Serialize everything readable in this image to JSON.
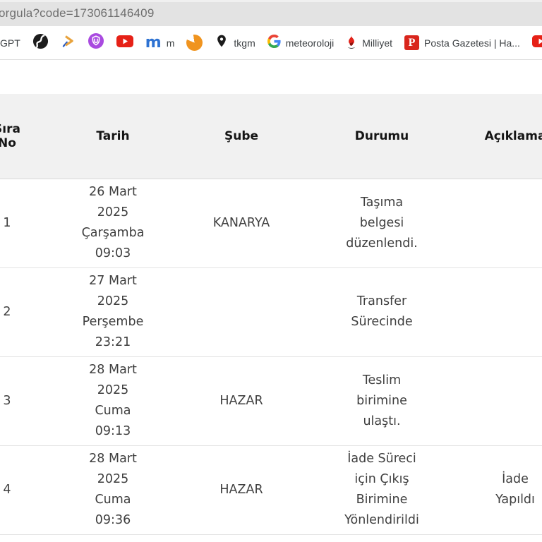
{
  "browser": {
    "address": {
      "url": "orgula?code=173061146409"
    },
    "bookmarks_bar": {
      "items": [
        {
          "label": "GPT",
          "icon": "text-only"
        },
        {
          "label": "",
          "icon": "globe"
        },
        {
          "label": "",
          "icon": "gold-arrow"
        },
        {
          "label": "",
          "icon": "purple-shield"
        },
        {
          "label": "",
          "icon": "youtube"
        },
        {
          "label": "m",
          "icon": "letter-m"
        },
        {
          "label": "",
          "icon": "orange-moon"
        },
        {
          "label": "tkgm",
          "icon": "map-pin"
        },
        {
          "label": "meteoroloji",
          "icon": "google-g"
        },
        {
          "label": "Milliyet",
          "icon": "flame"
        },
        {
          "label": "Posta Gazetesi | Ha...",
          "icon": "letter-p"
        },
        {
          "label": "",
          "icon": "youtube"
        }
      ]
    }
  },
  "table": {
    "headers": [
      "Sıra No",
      "Tarih",
      "Şube",
      "Durumu",
      "Açıklama"
    ],
    "rows": [
      {
        "no": "1",
        "tarih": [
          "26 Mart",
          "2025",
          "Çarşamba",
          "09:03"
        ],
        "sube": "KANARYA",
        "durumu": [
          "Taşıma",
          "belgesi",
          "düzenlendi."
        ],
        "aciklama": ""
      },
      {
        "no": "2",
        "tarih": [
          "27 Mart",
          "2025",
          "Perşembe",
          "23:21"
        ],
        "sube": "",
        "durumu": [
          "Transfer",
          "Sürecinde"
        ],
        "aciklama": ""
      },
      {
        "no": "3",
        "tarih": [
          "28 Mart",
          "2025",
          "Cuma",
          "09:13"
        ],
        "sube": "HAZAR",
        "durumu": [
          "Teslim",
          "birimine",
          "ulaştı."
        ],
        "aciklama": ""
      },
      {
        "no": "4",
        "tarih": [
          "28 Mart",
          "2025",
          "Cuma",
          "09:36"
        ],
        "sube": "HAZAR",
        "durumu": [
          "İade Süreci",
          "için Çıkış",
          "Birimine",
          "Yönlendirildi"
        ],
        "aciklama": [
          "İade",
          "Yapıldı"
        ]
      }
    ]
  },
  "colors": {
    "urlbar_bg": "#e3e3e3",
    "header_bg": "#f1f1f1",
    "youtube_red": "#e62117",
    "m_blue": "#2d72d2",
    "moon_orange": "#f0941f",
    "pin_black": "#1b1b1b",
    "flame_red": "#e2231a",
    "posta_red": "#d9251c",
    "shield_purple": "#a94ae0",
    "arrow_gold": "#e8a33d",
    "arrow_blue": "#2b5fc7"
  }
}
